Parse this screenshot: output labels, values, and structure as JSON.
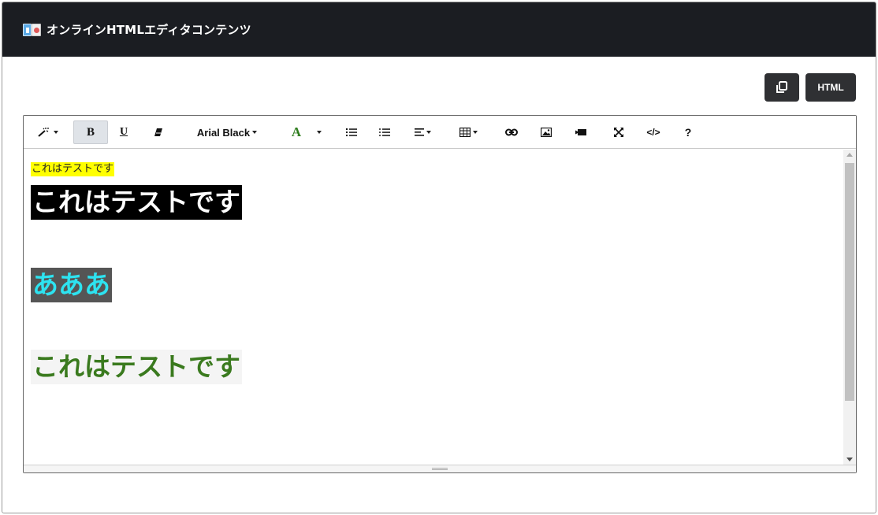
{
  "header": {
    "title": "オンラインHTMLエディタコンテンツ",
    "logo_icon": "editor-logo-icon"
  },
  "actions": {
    "copy_icon": "copy-icon",
    "html_label": "HTML"
  },
  "toolbar": {
    "style_icon": "magic-wand-icon",
    "bold_label": "B",
    "underline_label": "U",
    "clear_icon": "eraser-icon",
    "font_name": "Arial Black",
    "color_label": "A",
    "color_accent": "#2f7d1e",
    "unordered_list_icon": "unordered-list-icon",
    "ordered_list_icon": "ordered-list-icon",
    "align_icon": "align-left-icon",
    "table_icon": "table-icon",
    "link_icon": "link-icon",
    "image_icon": "image-icon",
    "video_icon": "video-icon",
    "fullscreen_icon": "fullscreen-icon",
    "codeview_label": "</>",
    "help_label": "?"
  },
  "content": {
    "line1": "これはテストです",
    "line2": "これはテストです",
    "line3": "あああ",
    "line4": "これはテストです"
  },
  "colors": {
    "header_bg": "#1b1d22",
    "button_bg": "#2f3033",
    "highlight_yellow": "#ffff00",
    "cyan_text": "#2de3f0",
    "green_text": "#3a7a1e"
  }
}
